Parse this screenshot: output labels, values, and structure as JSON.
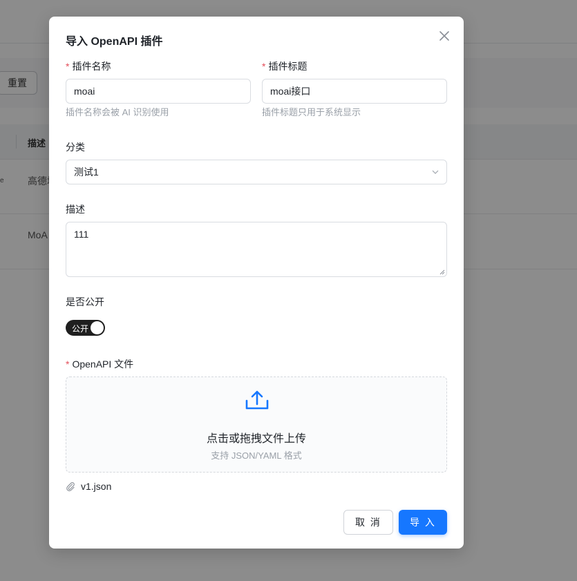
{
  "background": {
    "reset_label": "重置",
    "column_header": "描述",
    "rows": [
      "高德地",
      "MoA"
    ],
    "row_fragment": "e"
  },
  "modal": {
    "title": "导入 OpenAPI 插件",
    "required_mark": "*",
    "plugin_name": {
      "label": "插件名称",
      "value": "moai",
      "hint": "插件名称会被 AI 识别使用"
    },
    "plugin_title": {
      "label": "插件标题",
      "value": "moai接口",
      "hint": "插件标题只用于系统显示"
    },
    "category": {
      "label": "分类",
      "value": "测试1"
    },
    "description": {
      "label": "描述",
      "value": "111"
    },
    "public": {
      "label": "是否公开",
      "switch_text": "公开",
      "checked": true
    },
    "openapi_file": {
      "label": "OpenAPI 文件",
      "upload_text": "点击或拖拽文件上传",
      "upload_hint": "支持 JSON/YAML 格式",
      "file_name": "v1.json"
    },
    "buttons": {
      "cancel": "取 消",
      "import": "导 入"
    }
  },
  "colors": {
    "primary": "#1677ff",
    "required": "#e34d59",
    "switch_on": "#1f1f1f"
  }
}
